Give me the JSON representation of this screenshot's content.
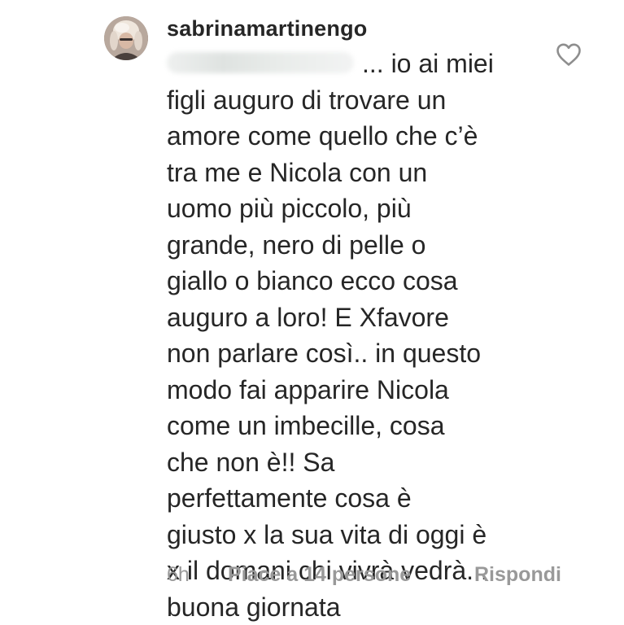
{
  "comment": {
    "username": "sabrinamartinengo",
    "text_lines": [
      "... io ai miei",
      "figli auguro di trovare un",
      "amore come quello che c’è",
      "tra me e Nicola con un",
      "uomo più piccolo, più",
      "grande, nero di pelle o",
      "giallo o bianco ecco cosa",
      "auguro a loro! E Xfavore",
      "non parlare così.. in questo",
      "modo fai apparire Nicola",
      "come un imbecille, cosa",
      "che non è!! Sa",
      "perfettamente cosa è",
      "giusto x la sua vita di oggi è",
      "x il domani chi vivrà vedrà...",
      "buona giornata"
    ],
    "time": "6h",
    "likes_label": "Piace a 14 persone",
    "reply_label": "Rispondi",
    "like_icon": "heart-outline-icon"
  },
  "colors": {
    "text": "#262626",
    "muted": "#999999",
    "background": "#ffffff"
  }
}
